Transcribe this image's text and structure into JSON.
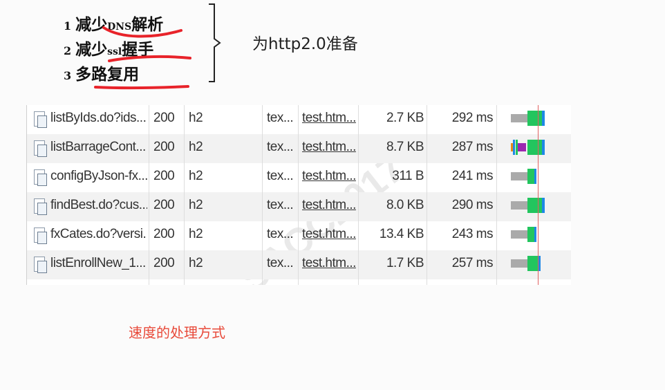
{
  "notes": [
    {
      "num": "1",
      "prefix": "减少",
      "small": "DNS",
      "suffix": "解析"
    },
    {
      "num": "2",
      "prefix": "减少",
      "small": "ssl",
      "suffix": "握手"
    },
    {
      "num": "3",
      "prefix": "多路复用",
      "small": "",
      "suffix": ""
    }
  ],
  "side_note": "为http2.0准备",
  "watermark": "SACC2017",
  "rows": [
    {
      "name": "listByIds.do?ids...",
      "status": "200",
      "protocol": "h2",
      "type": "tex...",
      "initiator": "test.htm...",
      "size": "2.7 KB",
      "time": "292 ms",
      "waterfall": [
        {
          "color": "#aaaaaa",
          "start": 0.0,
          "width": 0.42
        },
        {
          "color": "#22c55e",
          "start": 0.42,
          "width": 0.38
        },
        {
          "color": "#1e88e5",
          "start": 0.8,
          "width": 0.08
        }
      ]
    },
    {
      "name": "listBarrageCont...",
      "status": "200",
      "protocol": "h2",
      "type": "tex...",
      "initiator": "test.htm...",
      "size": "8.7 KB",
      "time": "287 ms",
      "waterfall": [
        {
          "color": "#e88a1a",
          "start": 0.0,
          "width": 0.06
        },
        {
          "color": "#1e88e5",
          "start": 0.06,
          "width": 0.06
        },
        {
          "color": "#22c55e",
          "start": 0.12,
          "width": 0.06
        },
        {
          "color": "#9c27b0",
          "start": 0.18,
          "width": 0.22
        },
        {
          "color": "#22c55e",
          "start": 0.42,
          "width": 0.38
        },
        {
          "color": "#1e88e5",
          "start": 0.8,
          "width": 0.08
        }
      ]
    },
    {
      "name": "configByJson-fx...",
      "status": "200",
      "protocol": "h2",
      "type": "tex...",
      "initiator": "test.htm...",
      "size": "311 B",
      "time": "241 ms",
      "waterfall": [
        {
          "color": "#aaaaaa",
          "start": 0.0,
          "width": 0.42
        },
        {
          "color": "#22c55e",
          "start": 0.42,
          "width": 0.18
        },
        {
          "color": "#1e88e5",
          "start": 0.6,
          "width": 0.05
        }
      ]
    },
    {
      "name": "findBest.do?cus...",
      "status": "200",
      "protocol": "h2",
      "type": "tex...",
      "initiator": "test.htm...",
      "size": "8.0 KB",
      "time": "290 ms",
      "waterfall": [
        {
          "color": "#aaaaaa",
          "start": 0.0,
          "width": 0.42
        },
        {
          "color": "#22c55e",
          "start": 0.42,
          "width": 0.38
        },
        {
          "color": "#1e88e5",
          "start": 0.8,
          "width": 0.08
        }
      ]
    },
    {
      "name": "fxCates.do?versi...",
      "status": "200",
      "protocol": "h2",
      "type": "tex...",
      "initiator": "test.htm...",
      "size": "13.4 KB",
      "time": "243 ms",
      "waterfall": [
        {
          "color": "#aaaaaa",
          "start": 0.0,
          "width": 0.42
        },
        {
          "color": "#22c55e",
          "start": 0.42,
          "width": 0.18
        },
        {
          "color": "#1e88e5",
          "start": 0.6,
          "width": 0.05
        }
      ]
    },
    {
      "name": "listEnrollNew_1...",
      "status": "200",
      "protocol": "h2",
      "type": "tex...",
      "initiator": "test.htm...",
      "size": "1.7 KB",
      "time": "257 ms",
      "waterfall": [
        {
          "color": "#aaaaaa",
          "start": 0.0,
          "width": 0.42
        },
        {
          "color": "#22c55e",
          "start": 0.42,
          "width": 0.3
        },
        {
          "color": "#1e88e5",
          "start": 0.72,
          "width": 0.06
        }
      ]
    }
  ],
  "caption": "速度的处理方式"
}
